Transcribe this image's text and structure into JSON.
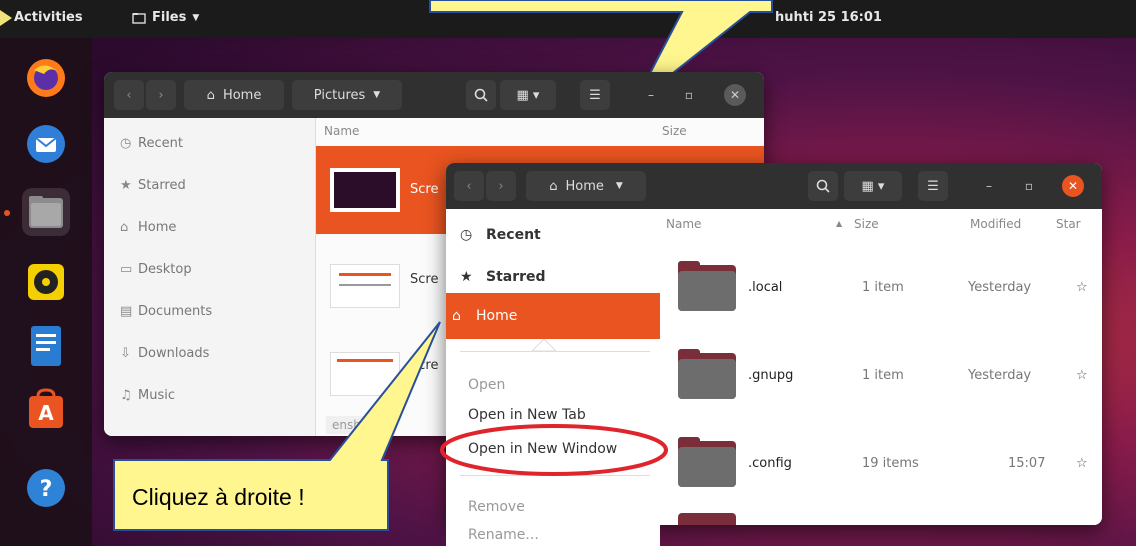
{
  "topbar": {
    "activities": "Activities",
    "app_menu": "Files",
    "clock": "huhti 25  16:01"
  },
  "dock": {
    "items": [
      "firefox-icon",
      "thunderbird-icon",
      "files-icon",
      "rhythmbox-icon",
      "writer-icon",
      "software-icon",
      "help-icon"
    ]
  },
  "back_window": {
    "path_home": "Home",
    "path_current": "Pictures",
    "col_name": "Name",
    "col_size": "Size",
    "sidebar": [
      "Recent",
      "Starred",
      "Home",
      "Desktop",
      "Documents",
      "Downloads",
      "Music"
    ],
    "file_prefix": [
      "Scre",
      "Scre",
      "Scre"
    ],
    "status": "enshot fr"
  },
  "front_window": {
    "path_home": "Home",
    "columns": {
      "name": "Name",
      "size": "Size",
      "modified": "Modified",
      "star": "Star"
    },
    "rows": [
      {
        "name": ".local",
        "size": "1 item",
        "modified": "Yesterday"
      },
      {
        "name": ".gnupg",
        "size": "1 item",
        "modified": "Yesterday"
      },
      {
        "name": ".config",
        "size": "19 items",
        "modified": "15:07"
      }
    ],
    "sidebar": [
      "Recent",
      "Starred",
      "Home"
    ]
  },
  "context_menu": {
    "items": [
      "Open",
      "Open in New Tab",
      "Open in New Window",
      "Remove",
      "Rename..."
    ]
  },
  "callout": {
    "text": "Cliquez à droite !"
  },
  "colors": {
    "accent": "#e95420",
    "callout_fill": "#fff68f",
    "highlight_ring": "#e0242c"
  }
}
